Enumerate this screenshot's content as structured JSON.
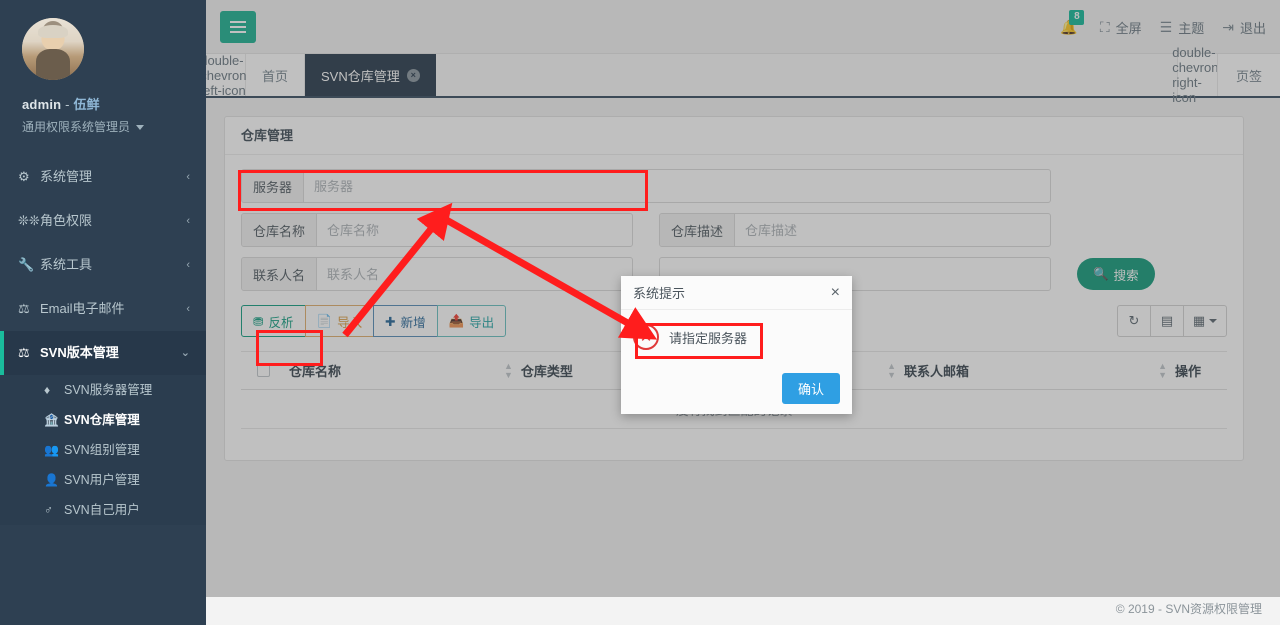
{
  "sidebar": {
    "profile": {
      "avatar_icon": "user-avatar-photo",
      "username": "admin",
      "separator": "-",
      "nickname": "伍鲜",
      "role": "通用权限系统管理员"
    },
    "items": [
      {
        "label": "系统管理",
        "icon": "gear-icon",
        "arrow": "‹",
        "active": false
      },
      {
        "label": "角色权限",
        "icon": "sliders-icon",
        "arrow": "‹",
        "active": false
      },
      {
        "label": "系统工具",
        "icon": "wrench-icon",
        "arrow": "‹",
        "active": false
      },
      {
        "label": "Email电子邮件",
        "icon": "balance-scale-icon",
        "arrow": "‹",
        "active": false
      },
      {
        "label": "SVN版本管理",
        "icon": "balance-scale-icon",
        "arrow": "⌄",
        "active": true
      }
    ],
    "submenu": [
      {
        "label": "SVN服务器管理",
        "icon": "diamond-icon",
        "active": false
      },
      {
        "label": "SVN仓库管理",
        "icon": "bank-icon",
        "active": true
      },
      {
        "label": "SVN组别管理",
        "icon": "users-icon",
        "active": false
      },
      {
        "label": "SVN用户管理",
        "icon": "user-icon",
        "active": false
      },
      {
        "label": "SVN自己用户",
        "icon": "male-icon",
        "active": false
      }
    ]
  },
  "topbar": {
    "menu_toggle_icon": "hamburger-icon",
    "bell_icon": "bell-icon",
    "bell_badge": "8",
    "fullscreen_icon": "expand-icon",
    "fullscreen_label": "全屏",
    "theme_icon": "theme-lines-icon",
    "theme_label": "主题",
    "logout_icon": "sign-out-icon",
    "logout_label": "退出"
  },
  "tabs": {
    "prev_icon": "double-chevron-left-icon",
    "next_icon": "double-chevron-right-icon",
    "items": [
      {
        "label": "首页",
        "closable": false,
        "active": false
      },
      {
        "label": "SVN仓库管理",
        "closable": true,
        "close_icon": "×",
        "active": true
      }
    ],
    "label_button": "页签"
  },
  "panel": {
    "title": "仓库管理",
    "fields": [
      {
        "label": "服务器",
        "placeholder": "服务器",
        "value": "",
        "name": "server"
      },
      {
        "label": "仓库名称",
        "placeholder": "仓库名称",
        "value": "",
        "name": "repo-name"
      },
      {
        "label": "仓库描述",
        "placeholder": "仓库描述",
        "value": "",
        "name": "repo-desc"
      },
      {
        "label": "联系人名",
        "placeholder": "联系人名",
        "value": "",
        "name": "contact-name"
      }
    ],
    "search_button": {
      "label": "搜索",
      "icon": "search-icon"
    },
    "toolbar_buttons": [
      {
        "label": "反析",
        "icon": "inbox-icon",
        "style": "success"
      },
      {
        "label": "导入",
        "icon": "file-icon",
        "style": "warning"
      },
      {
        "label": "新增",
        "icon": "plus-icon",
        "style": "primary"
      },
      {
        "label": "导出",
        "icon": "export-icon",
        "style": "info"
      }
    ],
    "table_tools": [
      {
        "icon": "refresh-icon",
        "name": "refresh-button"
      },
      {
        "icon": "list-view-icon",
        "name": "toggle-view-button"
      },
      {
        "icon": "columns-grid-icon",
        "name": "columns-button",
        "caret": true
      }
    ],
    "table": {
      "columns": [
        "仓库名称",
        "仓库类型",
        "联系人邮箱",
        "操作"
      ],
      "rows": [],
      "empty_text": "没有找到匹配的记录"
    }
  },
  "modal": {
    "title": "系统提示",
    "close_icon": "×",
    "error_icon": "circle-x-icon",
    "message": "请指定服务器",
    "confirm_label": "确认"
  },
  "footer": {
    "text": "© 2019 - SVN资源权限管理"
  },
  "colors": {
    "sidebar_bg": "#2e4052",
    "accent_green": "#1abc9c",
    "annotation_red": "#ff1d1d",
    "primary_blue": "#2f9fe3"
  }
}
